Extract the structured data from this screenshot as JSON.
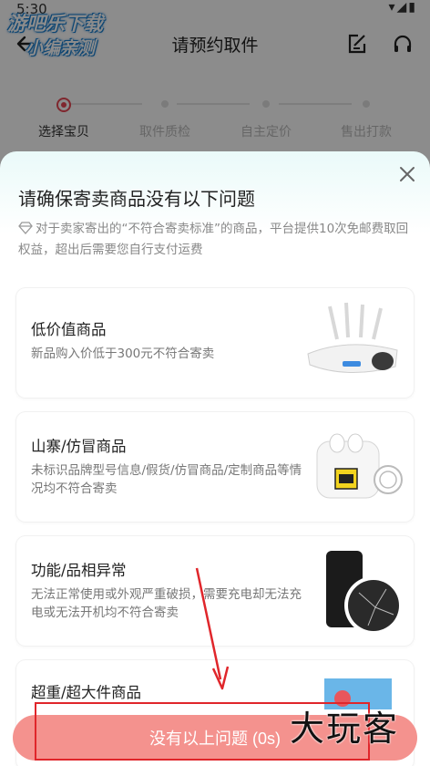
{
  "status_bar": {
    "time": "5:30",
    "icons": "▾◢▮"
  },
  "watermark_top": {
    "line1": "游吧乐下载",
    "line2": "小编亲测"
  },
  "nav": {
    "title": "请预约取件"
  },
  "steps": [
    {
      "label": "选择宝贝",
      "active": true
    },
    {
      "label": "取件质检",
      "active": false
    },
    {
      "label": "自主定价",
      "active": false
    },
    {
      "label": "售出打款",
      "active": false
    }
  ],
  "sheet": {
    "title": "请确保寄卖商品没有以下问题",
    "note": "对于卖家寄出的“不符合寄卖标准”的商品，平台提供10次免邮费取回权益，超出后需要您自行支付运费",
    "cards": [
      {
        "title": "低价值商品",
        "desc": "新品购入价低于300元不符合寄卖",
        "image": "router-massager-image"
      },
      {
        "title": "山寨/仿冒商品",
        "desc": "未标识品牌型号信息/假货/仿冒商品/定制商品等情况均不符合寄卖",
        "image": "earbuds-image"
      },
      {
        "title": "功能/品相异常",
        "desc": "无法正常使用或外观严重破损，需要充电却无法充电或无法开机均不符合寄卖",
        "image": "broken-phone-image"
      },
      {
        "title": "超重/超大件商品",
        "desc": "",
        "image": "large-item-image"
      }
    ],
    "button_label": "没有以上问题 (0s)"
  },
  "watermark_bottom": "大玩客",
  "colors": {
    "accent": "#e84855",
    "button": "#f4928e",
    "annotation": "#e0262b"
  }
}
